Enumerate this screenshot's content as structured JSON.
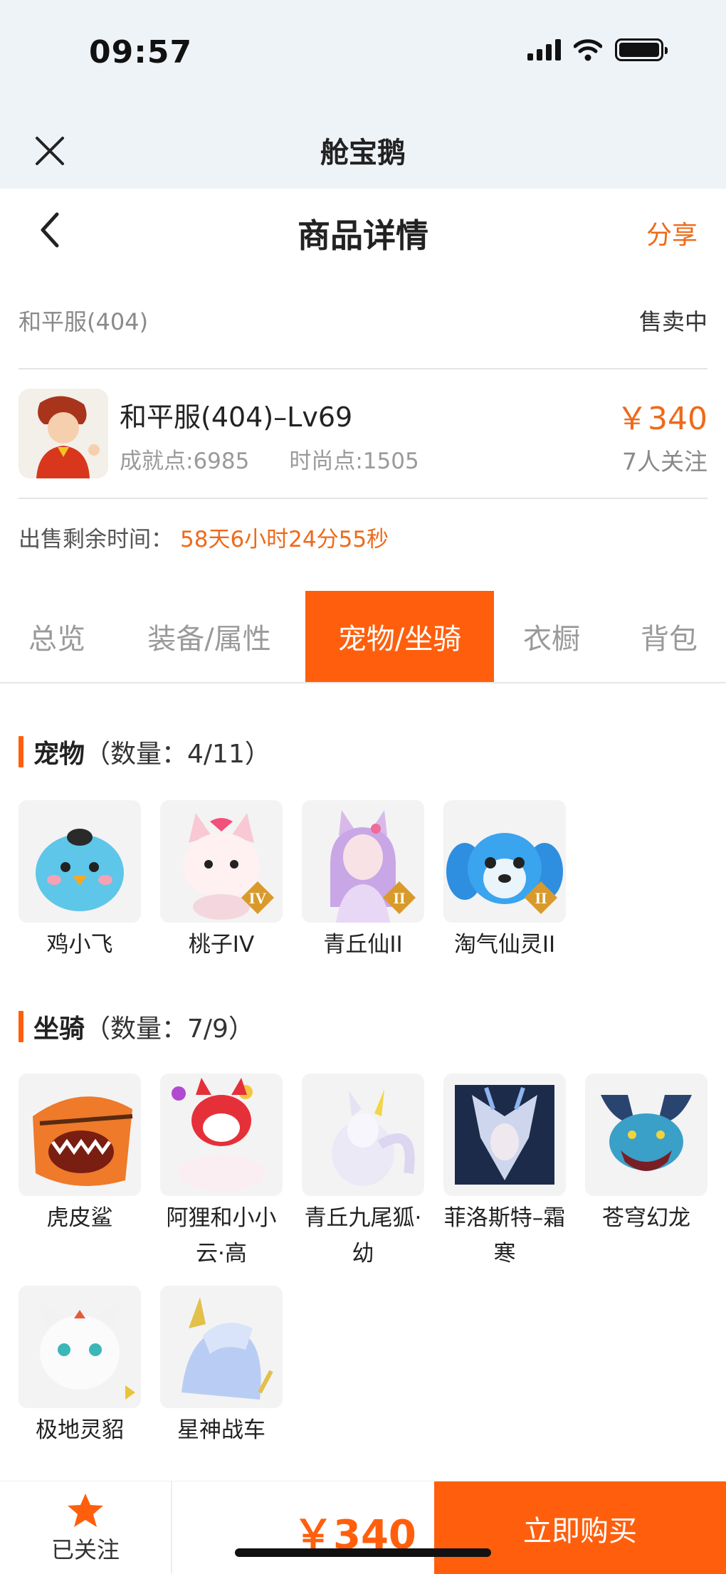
{
  "status": {
    "time": "09:57"
  },
  "app_bar": {
    "title": "舱宝鹅"
  },
  "nav": {
    "title": "商品详情",
    "share_label": "分享"
  },
  "listing": {
    "server": "和平服(404)",
    "sale_status": "售卖中",
    "item_name": "和平服(404)–Lv69",
    "achievement": "成就点:6985",
    "fashion": "时尚点:1505",
    "price": "￥340",
    "followers": "7人关注",
    "remaining_label": "出售剩余时间：",
    "remaining_time": "58天6小时24分55秒"
  },
  "tabs": [
    {
      "label": "总览",
      "active": false
    },
    {
      "label": "装备/属性",
      "active": false
    },
    {
      "label": "宠物/坐骑",
      "active": true
    },
    {
      "label": "衣橱",
      "active": false
    },
    {
      "label": "背包",
      "active": false
    }
  ],
  "pets": {
    "title": "宠物",
    "count": "（数量：4/11）",
    "items": [
      {
        "label": "鸡小飞",
        "badge": ""
      },
      {
        "label": "桃子IV",
        "badge": "IV"
      },
      {
        "label": "青丘仙II",
        "badge": "II"
      },
      {
        "label": "淘气仙灵II",
        "badge": "II"
      }
    ]
  },
  "mounts": {
    "title": "坐骑",
    "count": "（数量：7/9）",
    "items": [
      {
        "label": "虎皮鲨"
      },
      {
        "label": "阿狸和小小云·高"
      },
      {
        "label": "青丘九尾狐·幼"
      },
      {
        "label": "菲洛斯特–霜寒"
      },
      {
        "label": "苍穹幻龙"
      },
      {
        "label": "极地灵貂"
      },
      {
        "label": "星神战车"
      }
    ]
  },
  "bottom": {
    "follow_label": "已关注",
    "price": "￥340",
    "buy_label": "立即购买"
  },
  "colors": {
    "accent": "#ff5f0d",
    "price_text": "#ee6a1a"
  },
  "icons": [
    "signal-icon",
    "wifi-icon",
    "battery-icon",
    "close-icon",
    "back-icon",
    "star-icon",
    "rank-badge-icon"
  ]
}
